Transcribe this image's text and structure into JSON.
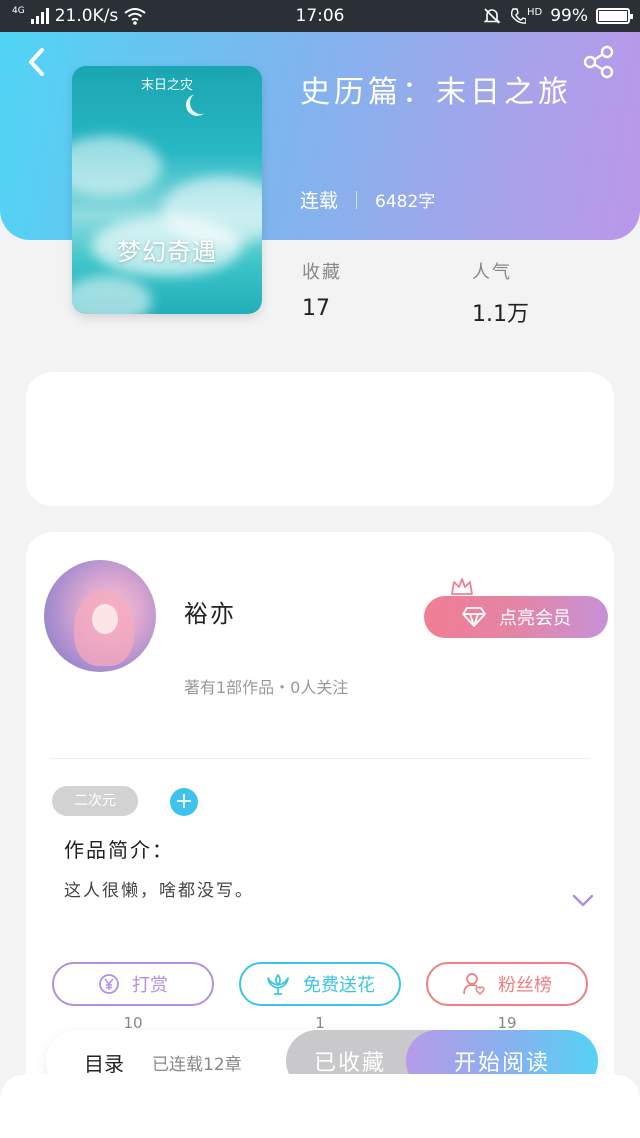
{
  "status_bar": {
    "network": "4G",
    "speed": "21.0K/s",
    "time": "17:06",
    "hd": "HD",
    "battery": "99%",
    "battery_level": 0.99
  },
  "book": {
    "cover_small_text": "末日之灾",
    "cover_title": "梦幻奇遇",
    "title": "史历篇：末日之旅",
    "status": "连载",
    "word_count": "6482字",
    "stats": [
      {
        "label": "收藏",
        "value": "17"
      },
      {
        "label": "人气",
        "value": "1.1万"
      }
    ]
  },
  "author": {
    "name": "裕亦",
    "summary": "著有1部作品・0人关注",
    "vip_label": "点亮会员"
  },
  "tags": [
    "二次元"
  ],
  "intro": {
    "title": "作品简介：",
    "text": "这人很懒，啥都没写。"
  },
  "actions": [
    {
      "label": "打赏",
      "count": "10",
      "color": "#b58fe0",
      "icon": "yen-coin-icon"
    },
    {
      "label": "免费送花",
      "count": "1",
      "color": "#3cc6e6",
      "icon": "flower-icon"
    },
    {
      "label": "粉丝榜",
      "count": "19",
      "color": "#ef7f82",
      "icon": "fan-person-icon"
    }
  ],
  "bottom_bar": {
    "toc_label": "目录",
    "toc_status": "已连载12章",
    "favorite_label": "已收藏",
    "read_label": "开始阅读"
  }
}
